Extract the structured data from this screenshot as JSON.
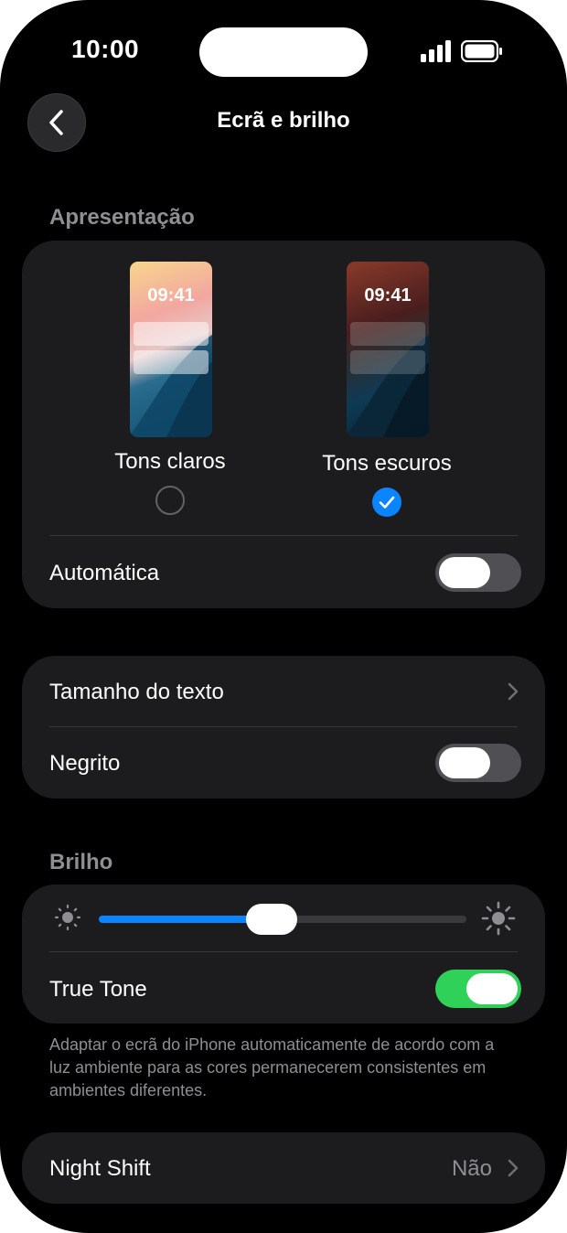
{
  "status_bar": {
    "time": "10:00"
  },
  "nav": {
    "title": "Ecrã e brilho",
    "back_icon": "chevron-left-icon"
  },
  "appearance": {
    "section_title": "Apresentação",
    "options": [
      {
        "label": "Tons claros",
        "preview_time": "09:41",
        "selected": false
      },
      {
        "label": "Tons escuros",
        "preview_time": "09:41",
        "selected": true
      }
    ],
    "automatic": {
      "label": "Automática",
      "on": false
    }
  },
  "text": {
    "text_size": {
      "label": "Tamanho do texto"
    },
    "bold": {
      "label": "Negrito",
      "on": false
    }
  },
  "brightness": {
    "section_title": "Brilho",
    "level": 0.47,
    "true_tone": {
      "label": "True Tone",
      "on": true
    },
    "footnote": "Adaptar o ecrã do iPhone automaticamente de acordo com a luz ambiente para as cores permanecerem consistentes em ambientes diferentes."
  },
  "night_shift": {
    "label": "Night Shift",
    "value": "Não"
  },
  "colors": {
    "accent": "#0a84ff",
    "toggle_on": "#30d158",
    "toggle_off": "#505054",
    "card": "#1c1c1e"
  }
}
